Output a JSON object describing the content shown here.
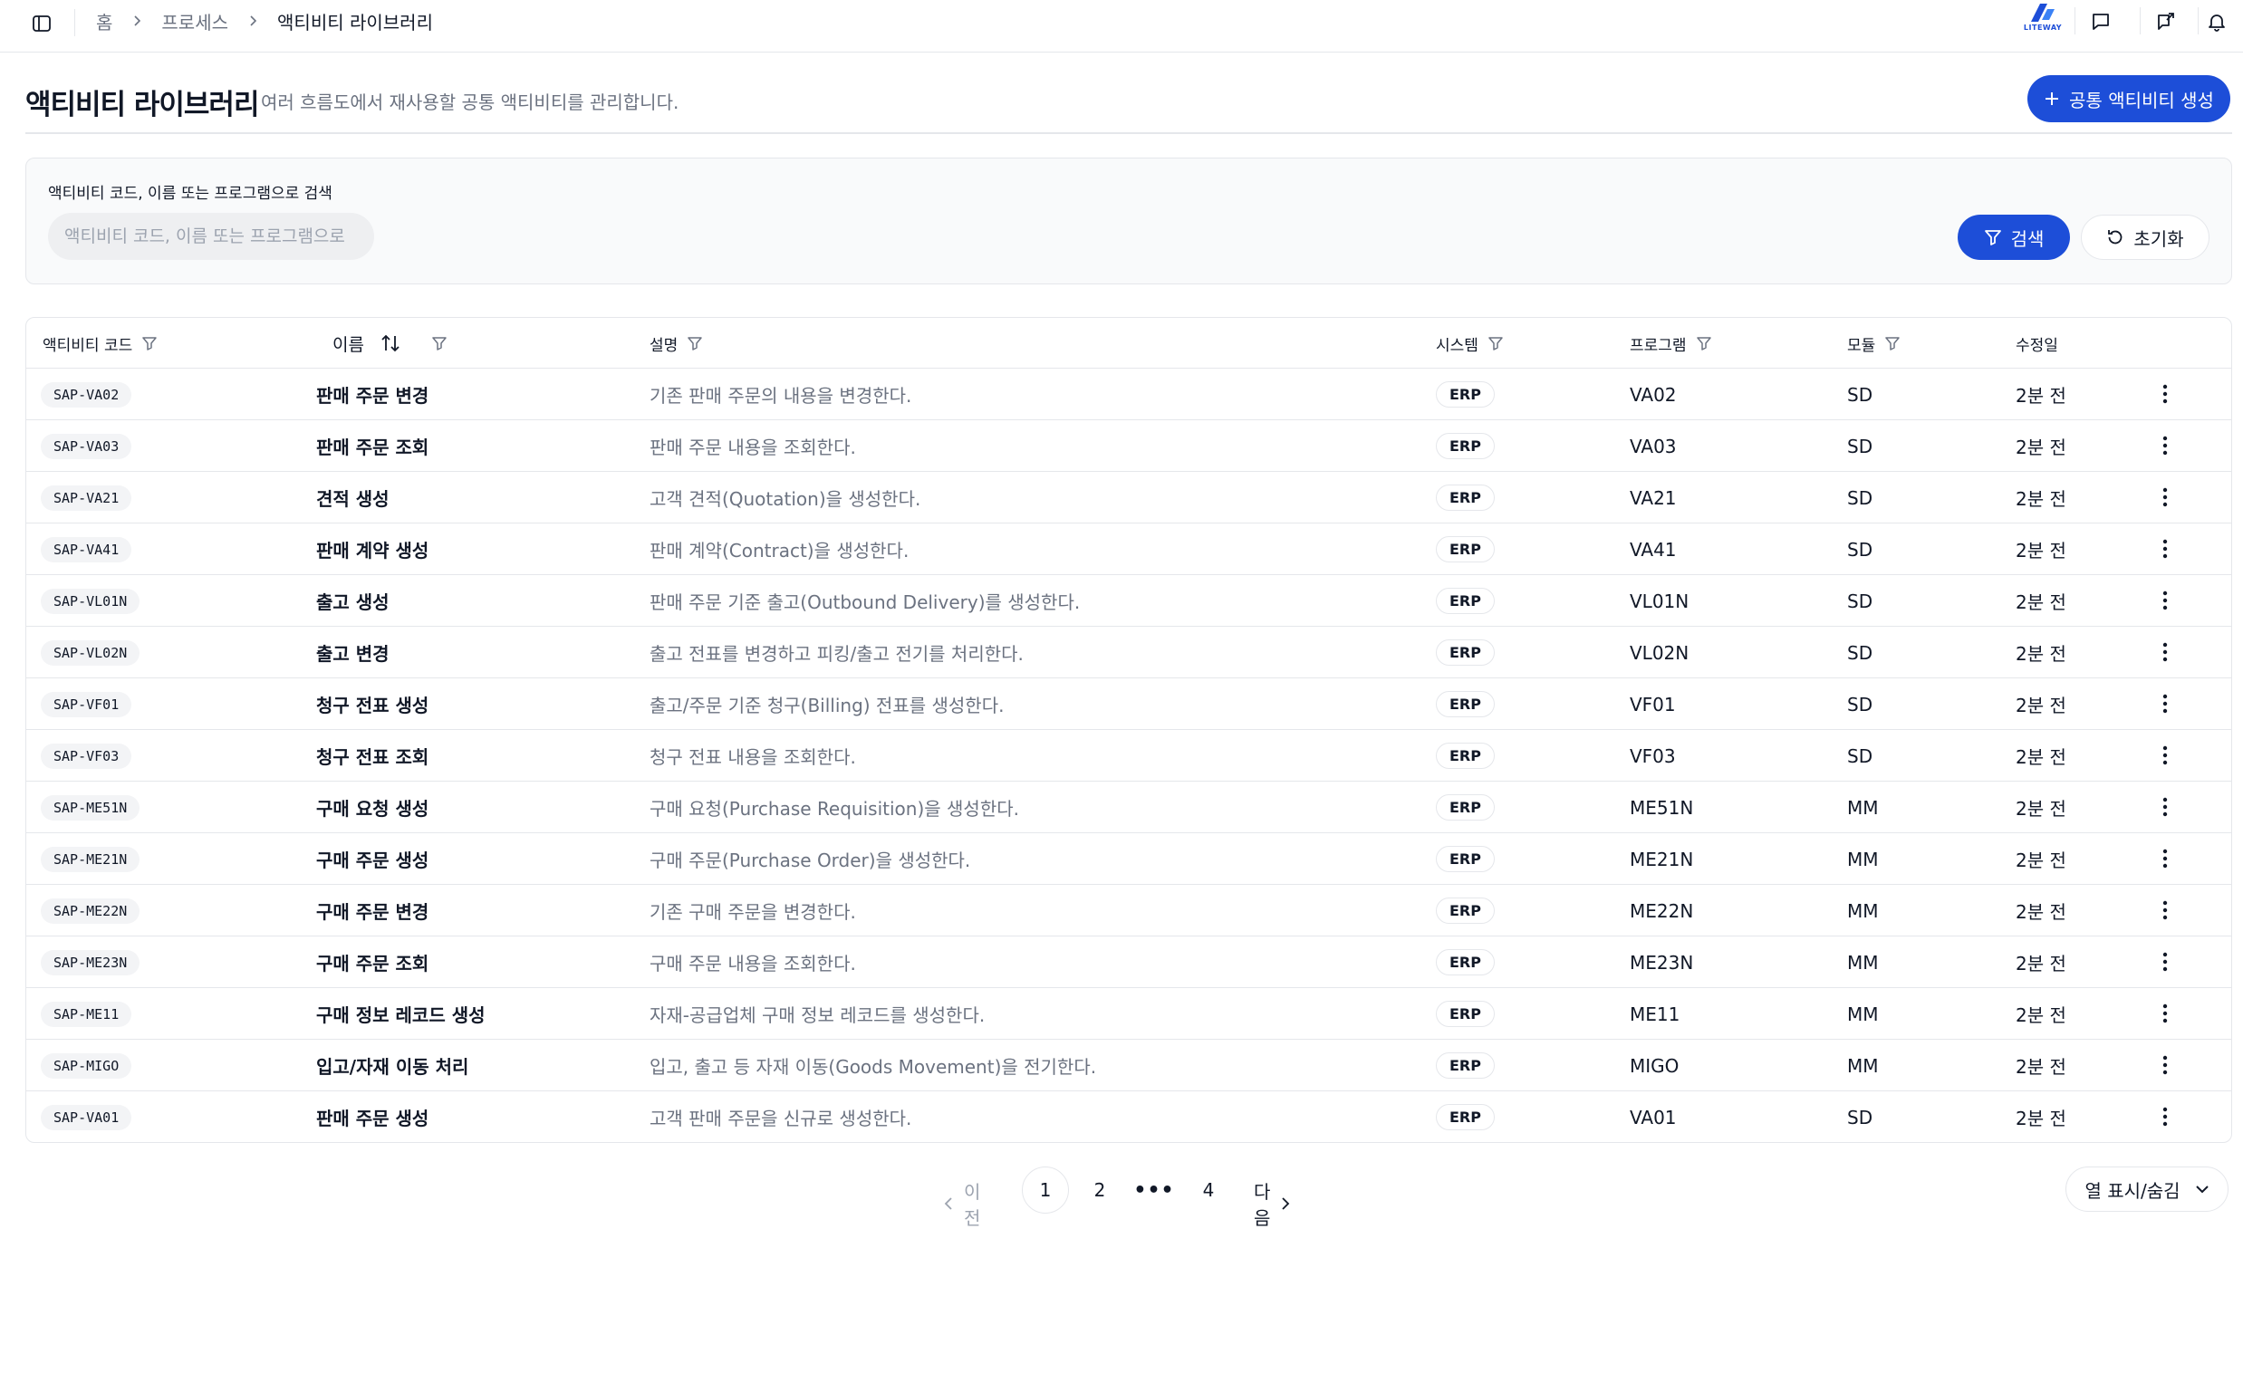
{
  "breadcrumb": {
    "home": "홈",
    "process": "프로세스",
    "current": "액티비티 라이브러리"
  },
  "logo": {
    "word": "LITEWAY"
  },
  "header": {
    "title": "액티비티 라이브러리",
    "description": "여러 흐름도에서 재사용할 공통 액티비티를 관리합니다.",
    "create_label": "공통 액티비티 생성"
  },
  "search": {
    "label": "액티비티 코드, 이름 또는 프로그램으로 검색",
    "placeholder": "액티비티 코드, 이름 또는 프로그램으로",
    "value": "",
    "search_label": "검색",
    "reset_label": "초기화"
  },
  "table": {
    "columns": {
      "code": "액티비티 코드",
      "name": "이름",
      "description": "설명",
      "system": "시스템",
      "program": "프로그램",
      "module": "모듈",
      "modified": "수정일"
    },
    "rows": [
      {
        "code": "SAP-VA02",
        "name": "판매 주문 변경",
        "description": "기존 판매 주문의 내용을 변경한다.",
        "system": "ERP",
        "program": "VA02",
        "module": "SD",
        "modified": "2분 전"
      },
      {
        "code": "SAP-VA03",
        "name": "판매 주문 조회",
        "description": "판매 주문 내용을 조회한다.",
        "system": "ERP",
        "program": "VA03",
        "module": "SD",
        "modified": "2분 전"
      },
      {
        "code": "SAP-VA21",
        "name": "견적 생성",
        "description": "고객 견적(Quotation)을 생성한다.",
        "system": "ERP",
        "program": "VA21",
        "module": "SD",
        "modified": "2분 전"
      },
      {
        "code": "SAP-VA41",
        "name": "판매 계약 생성",
        "description": "판매 계약(Contract)을 생성한다.",
        "system": "ERP",
        "program": "VA41",
        "module": "SD",
        "modified": "2분 전"
      },
      {
        "code": "SAP-VL01N",
        "name": "출고 생성",
        "description": "판매 주문 기준 출고(Outbound Delivery)를 생성한다.",
        "system": "ERP",
        "program": "VL01N",
        "module": "SD",
        "modified": "2분 전"
      },
      {
        "code": "SAP-VL02N",
        "name": "출고 변경",
        "description": "출고 전표를 변경하고 피킹/출고 전기를 처리한다.",
        "system": "ERP",
        "program": "VL02N",
        "module": "SD",
        "modified": "2분 전"
      },
      {
        "code": "SAP-VF01",
        "name": "청구 전표 생성",
        "description": "출고/주문 기준 청구(Billing) 전표를 생성한다.",
        "system": "ERP",
        "program": "VF01",
        "module": "SD",
        "modified": "2분 전"
      },
      {
        "code": "SAP-VF03",
        "name": "청구 전표 조회",
        "description": "청구 전표 내용을 조회한다.",
        "system": "ERP",
        "program": "VF03",
        "module": "SD",
        "modified": "2분 전"
      },
      {
        "code": "SAP-ME51N",
        "name": "구매 요청 생성",
        "description": "구매 요청(Purchase Requisition)을 생성한다.",
        "system": "ERP",
        "program": "ME51N",
        "module": "MM",
        "modified": "2분 전"
      },
      {
        "code": "SAP-ME21N",
        "name": "구매 주문 생성",
        "description": "구매 주문(Purchase Order)을 생성한다.",
        "system": "ERP",
        "program": "ME21N",
        "module": "MM",
        "modified": "2분 전"
      },
      {
        "code": "SAP-ME22N",
        "name": "구매 주문 변경",
        "description": "기존 구매 주문을 변경한다.",
        "system": "ERP",
        "program": "ME22N",
        "module": "MM",
        "modified": "2분 전"
      },
      {
        "code": "SAP-ME23N",
        "name": "구매 주문 조회",
        "description": "구매 주문 내용을 조회한다.",
        "system": "ERP",
        "program": "ME23N",
        "module": "MM",
        "modified": "2분 전"
      },
      {
        "code": "SAP-ME11",
        "name": "구매 정보 레코드 생성",
        "description": "자재-공급업체 구매 정보 레코드를 생성한다.",
        "system": "ERP",
        "program": "ME11",
        "module": "MM",
        "modified": "2분 전"
      },
      {
        "code": "SAP-MIGO",
        "name": "입고/자재 이동 처리",
        "description": "입고, 출고 등 자재 이동(Goods Movement)을 전기한다.",
        "system": "ERP",
        "program": "MIGO",
        "module": "MM",
        "modified": "2분 전"
      },
      {
        "code": "SAP-VA01",
        "name": "판매 주문 생성",
        "description": "고객 판매 주문을 신규로 생성한다.",
        "system": "ERP",
        "program": "VA01",
        "module": "SD",
        "modified": "2분 전"
      }
    ]
  },
  "pagination": {
    "prev_label": "이전",
    "next_label": "다음",
    "pages": [
      "1",
      "2",
      "4"
    ],
    "ellipsis": "•••",
    "current": "1"
  },
  "column_toggle_label": "열 표시/숨김",
  "colors": {
    "accent": "#1d4ed8",
    "border": "#e5e7eb",
    "muted_text": "#6b7280"
  },
  "icons": [
    "sidebar-toggle-icon",
    "chevron-right-icon",
    "liteway-logo",
    "message-icon",
    "share-icon",
    "bell-icon",
    "plus-icon",
    "filter-icon",
    "reset-icon",
    "sort-icon",
    "more-vertical-icon",
    "chevron-left-icon",
    "chevron-down-icon"
  ]
}
